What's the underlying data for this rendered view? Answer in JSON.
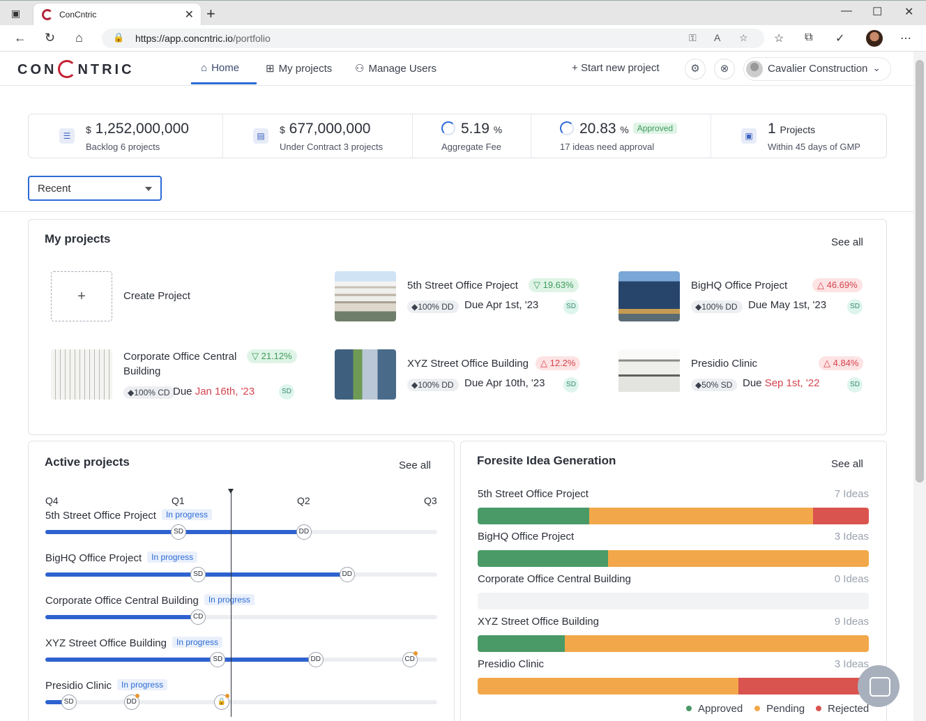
{
  "browser": {
    "tab_title": "ConCntric",
    "url_host": "https://app.concntric.io",
    "url_path": "/portfolio"
  },
  "header": {
    "logo": "CONCNTRIC",
    "nav": [
      "Home",
      "My projects",
      "Manage Users"
    ],
    "start_project": "Start new project",
    "company": "Cavalier Construction"
  },
  "stats": [
    {
      "prefix": "$",
      "value": "1,252,000,000",
      "suffix": "",
      "sub": "Backlog 6 projects"
    },
    {
      "prefix": "$",
      "value": "677,000,000",
      "suffix": "",
      "sub": "Under Contract 3 projects"
    },
    {
      "prefix": "",
      "value": "5.19",
      "suffix": "%",
      "sub": "Aggregate Fee"
    },
    {
      "prefix": "",
      "value": "20.83",
      "suffix": "%",
      "badge": "Approved",
      "sub": "17 ideas need approval"
    },
    {
      "prefix": "",
      "value": "1",
      "suffix": "Projects",
      "sub": "Within 45 days of GMP"
    }
  ],
  "filter": {
    "selected": "Recent"
  },
  "my_projects": {
    "title": "My projects",
    "see_all": "See all",
    "create": {
      "plus": "+",
      "label": "Create Project"
    },
    "items": [
      {
        "name": "5th Street Office Project",
        "pct": "19.63%",
        "trend": "up",
        "phase": "100% DD",
        "due_prefix": "Due ",
        "due": "Apr 1st, '23",
        "overdue": false,
        "tag": "SD"
      },
      {
        "name": "BigHQ Office Project",
        "pct": "46.69%",
        "trend": "down",
        "phase": "100% DD",
        "due_prefix": "Due ",
        "due": "May 1st, '23",
        "overdue": false,
        "tag": "SD"
      },
      {
        "name": "Corporate Office Central Building",
        "pct": "21.12%",
        "trend": "up",
        "phase": "100% CD",
        "due_prefix": "Due ",
        "due": "Jan 16th, '23",
        "overdue": true,
        "tag": "SD"
      },
      {
        "name": "XYZ Street Office Building",
        "pct": "12.2%",
        "trend": "down",
        "phase": "100% DD",
        "due_prefix": "Due ",
        "due": "Apr 10th, '23",
        "overdue": false,
        "tag": "SD"
      },
      {
        "name": "Presidio Clinic",
        "pct": "4.84%",
        "trend": "down",
        "phase": "50% SD",
        "due_prefix": "Due ",
        "due": "Sep 1st, '22",
        "overdue": true,
        "tag": "SD"
      }
    ]
  },
  "active_projects": {
    "title": "Active projects",
    "see_all": "See all",
    "quarters": [
      "Q4",
      "Q1",
      "Q2",
      "Q3"
    ],
    "now_fraction": 0.474,
    "rows": [
      {
        "name": "5th Street Office Project",
        "status": "In progress",
        "progress": 0.66,
        "markers": [
          {
            "label": "SD",
            "at": 0.34
          },
          {
            "label": "DD",
            "at": 0.66
          }
        ]
      },
      {
        "name": "BigHQ Office Project",
        "status": "In progress",
        "progress": 0.77,
        "markers": [
          {
            "label": "SD",
            "at": 0.39
          },
          {
            "label": "DD",
            "at": 0.77
          }
        ]
      },
      {
        "name": "Corporate Office Central Building",
        "status": "In progress",
        "progress": 0.39,
        "markers": [
          {
            "label": "CD",
            "at": 0.39
          }
        ]
      },
      {
        "name": "XYZ Street Office Building",
        "status": "In progress",
        "progress": 0.69,
        "markers": [
          {
            "label": "SD",
            "at": 0.44
          },
          {
            "label": "DD",
            "at": 0.69
          },
          {
            "label": "CD",
            "at": 0.93,
            "dot": true
          }
        ]
      },
      {
        "name": "Presidio Clinic",
        "status": "In progress",
        "progress": 0.06,
        "markers": [
          {
            "label": "SD",
            "at": 0.06
          },
          {
            "label": "DD",
            "at": 0.22,
            "dot": true
          },
          {
            "label": "🔒",
            "at": 0.45,
            "dot": true
          }
        ]
      }
    ]
  },
  "ideas": {
    "title": "Foresite Idea Generation",
    "see_all": "See all",
    "rows": [
      {
        "name": "5th Street Office Project",
        "count": "7 Ideas",
        "approved": 0.286,
        "pending": 0.572,
        "rejected": 0.142
      },
      {
        "name": "BigHQ Office Project",
        "count": "3 Ideas",
        "approved": 0.333,
        "pending": 0.667,
        "rejected": 0
      },
      {
        "name": "Corporate Office Central Building",
        "count": "0 Ideas",
        "approved": 0,
        "pending": 0,
        "rejected": 0
      },
      {
        "name": "XYZ Street Office Building",
        "count": "9 Ideas",
        "approved": 0.222,
        "pending": 0.778,
        "rejected": 0
      },
      {
        "name": "Presidio Clinic",
        "count": "3 Ideas",
        "approved": 0,
        "pending": 0.667,
        "rejected": 0.333
      }
    ],
    "legend": [
      "Approved",
      "Pending",
      "Rejected"
    ],
    "colors": {
      "approved": "#4a9a68",
      "pending": "#f2a84a",
      "rejected": "#d9534f"
    }
  }
}
